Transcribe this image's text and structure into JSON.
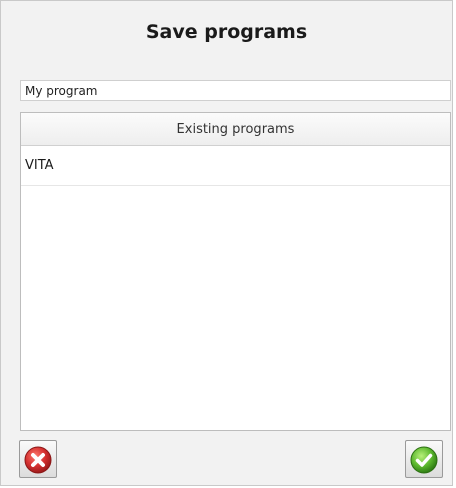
{
  "dialog": {
    "title": "Save programs",
    "name_input": {
      "value": "My program",
      "placeholder": ""
    },
    "list": {
      "header": "Existing programs",
      "items": [
        {
          "label": "VITA"
        }
      ]
    },
    "buttons": {
      "cancel_icon": "red-x-circle-icon",
      "confirm_icon": "green-checkmark-circle-icon"
    }
  },
  "colors": {
    "cancel_red": "#d32f2f",
    "confirm_green": "#5cb82e",
    "dialog_bg": "#f2f2f2"
  }
}
